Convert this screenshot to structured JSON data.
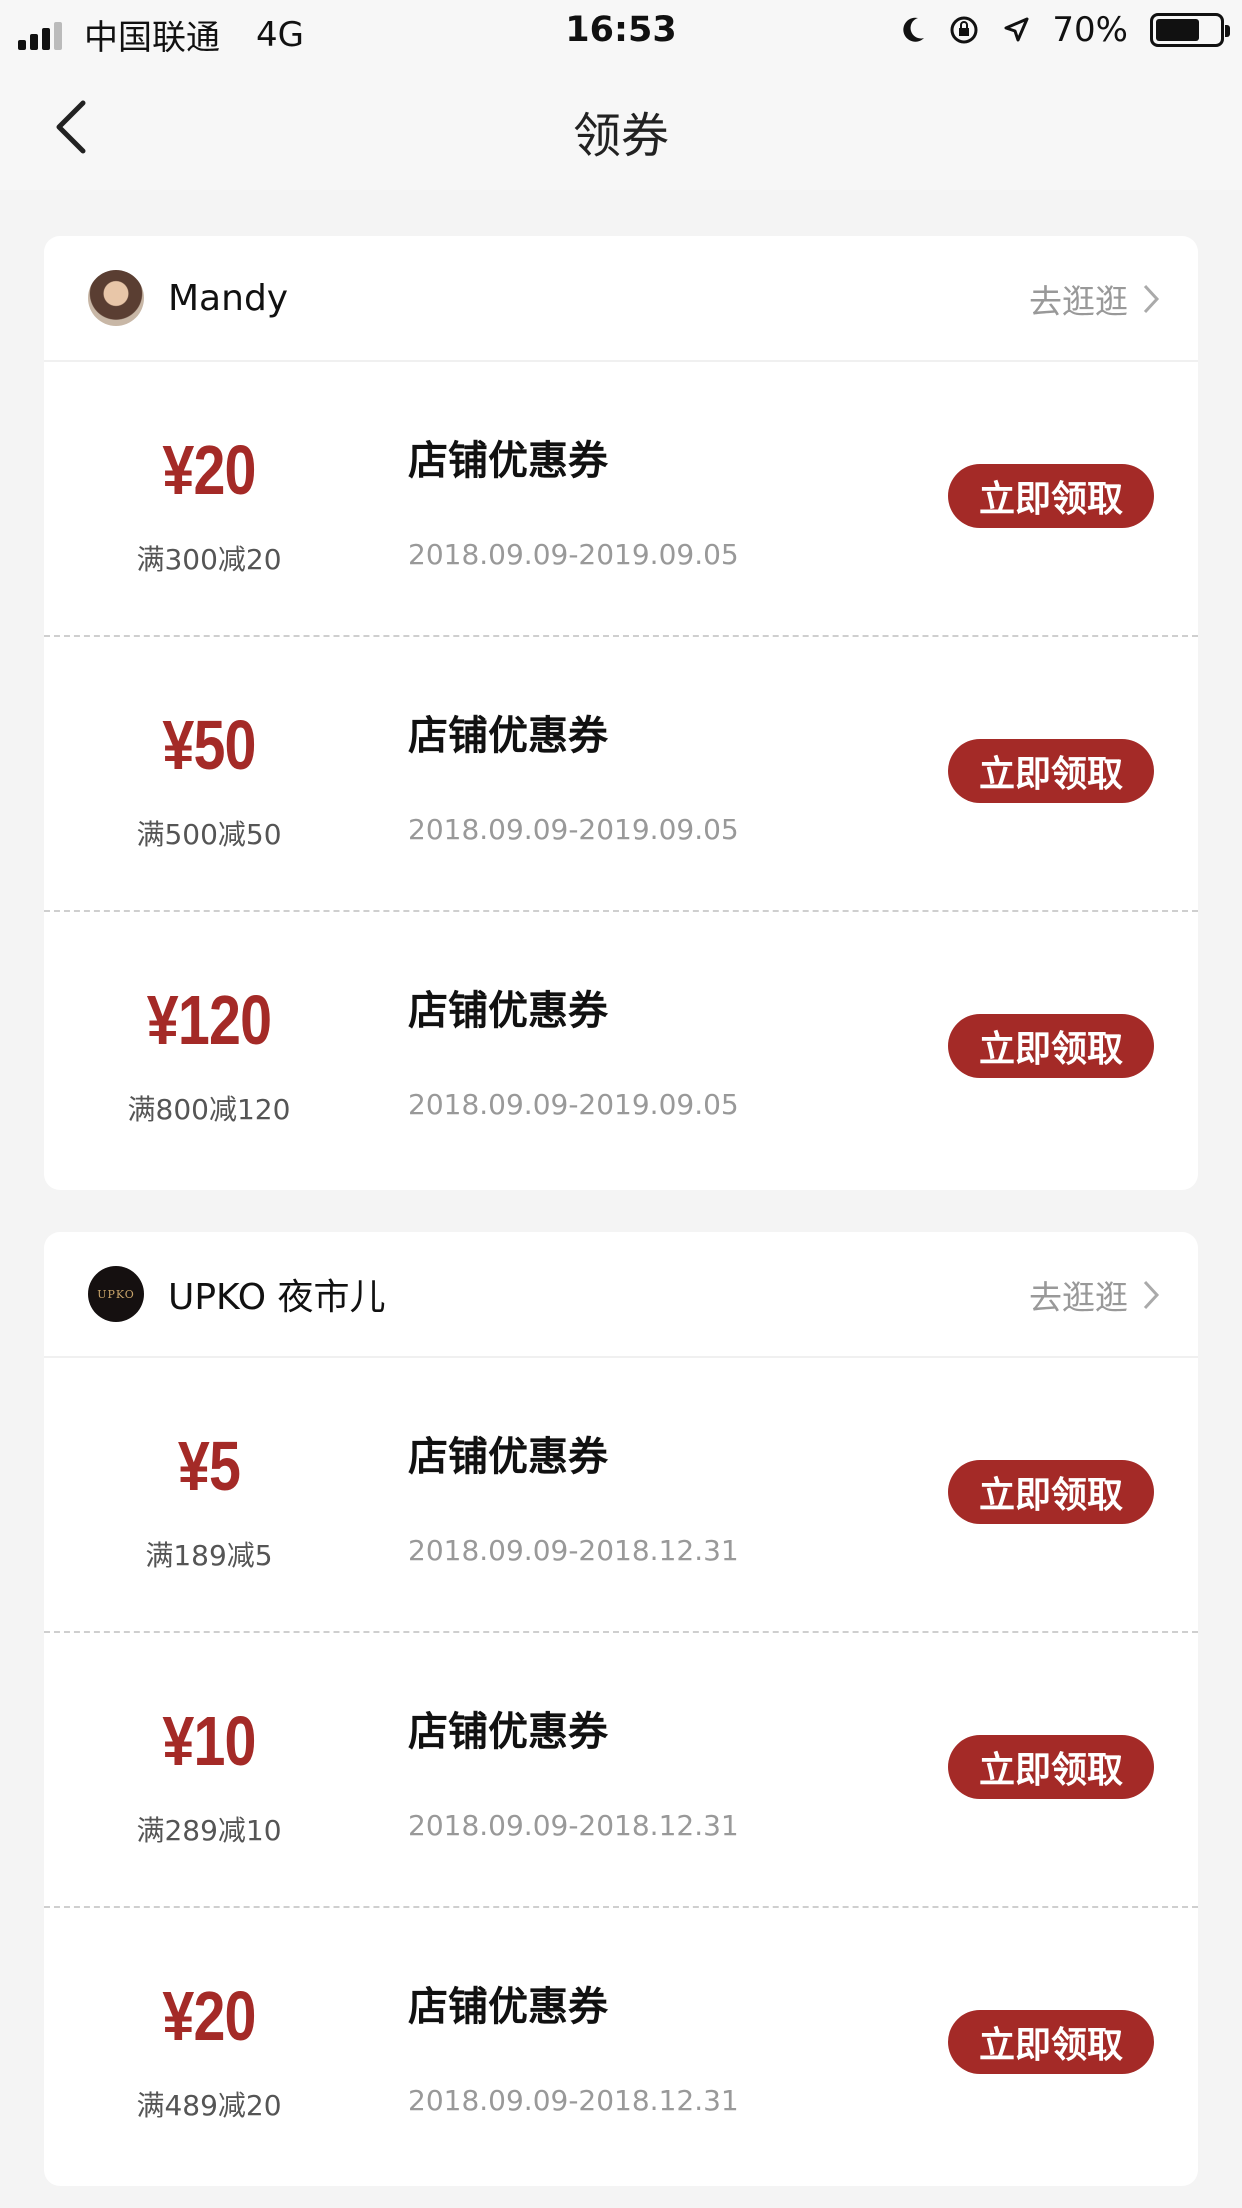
{
  "status_bar": {
    "carrier": "中国联通",
    "network": "4G",
    "time": "16:53",
    "battery": "70%"
  },
  "nav": {
    "title": "领券"
  },
  "shops": [
    {
      "name": "Mandy",
      "visit_label": "去逛逛",
      "coupons": [
        {
          "amount": "¥20",
          "condition": "满300减20",
          "title": "店铺优惠券",
          "date": "2018.09.09-2019.09.05",
          "button": "立即领取"
        },
        {
          "amount": "¥50",
          "condition": "满500减50",
          "title": "店铺优惠券",
          "date": "2018.09.09-2019.09.05",
          "button": "立即领取"
        },
        {
          "amount": "¥120",
          "condition": "满800减120",
          "title": "店铺优惠券",
          "date": "2018.09.09-2019.09.05",
          "button": "立即领取"
        }
      ]
    },
    {
      "name": "UPKO 夜市儿",
      "logo_text": "UPKO",
      "visit_label": "去逛逛",
      "coupons": [
        {
          "amount": "¥5",
          "condition": "满189减5",
          "title": "店铺优惠券",
          "date": "2018.09.09-2018.12.31",
          "button": "立即领取"
        },
        {
          "amount": "¥10",
          "condition": "满289减10",
          "title": "店铺优惠券",
          "date": "2018.09.09-2018.12.31",
          "button": "立即领取"
        },
        {
          "amount": "¥20",
          "condition": "满489减20",
          "title": "店铺优惠券",
          "date": "2018.09.09-2018.12.31",
          "button": "立即领取"
        }
      ]
    }
  ],
  "colors": {
    "accent": "#a42a27",
    "background": "#f4f4f4"
  }
}
